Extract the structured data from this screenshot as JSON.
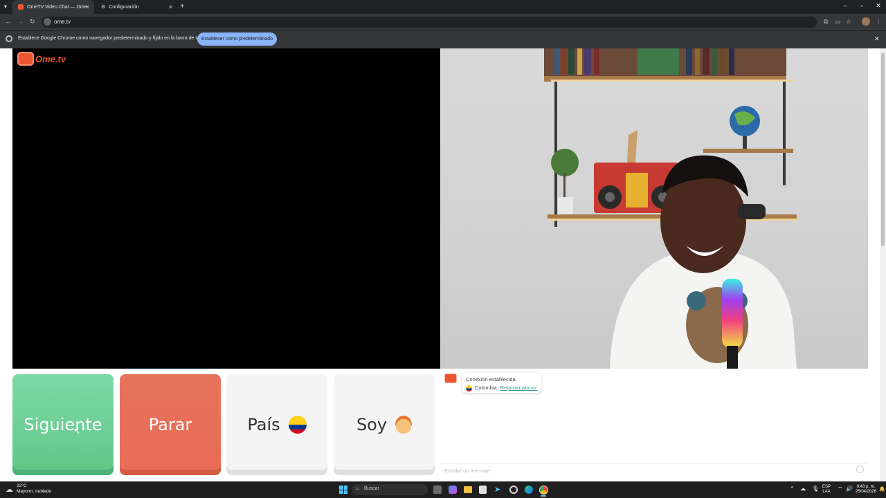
{
  "browser": {
    "tabs": [
      {
        "label": "OmeTV Video Chat — Ome",
        "active": true
      },
      {
        "label": "Configuración",
        "active": false
      }
    ],
    "url": "ome.tv",
    "infobar_text": "Establece Google Chrome como navegador predeterminado y fíjalo en la barra de tareas",
    "infobar_button": "Establecer como predeterminado"
  },
  "logo": "Ome.tv",
  "buttons": {
    "next": "Siguiente",
    "stop": "Parar",
    "country": "País",
    "soy": "Soy"
  },
  "chat": {
    "status": "Conexión establecida.",
    "country": "Colombia.",
    "report_link": "Reportar abuso.",
    "input_placeholder": "Escribe un mensaje"
  },
  "taskbar": {
    "weather_temp": "22°C",
    "weather_desc": "Mayorm. nublado",
    "search": "Buscar",
    "lang_1": "ESP",
    "lang_2": "LAA",
    "time": "9:43 p. m.",
    "date": "25/04/2026"
  },
  "colors": {
    "next": "#6fd09a",
    "stop": "#e86b56",
    "accent_blue": "#8ab4f8",
    "link": "#3b9c8f"
  }
}
